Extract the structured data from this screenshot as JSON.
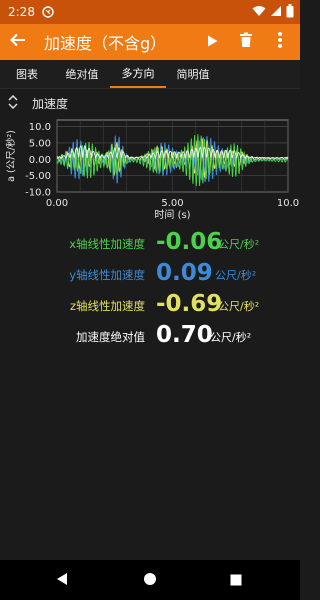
{
  "status": {
    "time": "2:28"
  },
  "toolbar": {
    "title": "加速度（不含g）"
  },
  "tabs": [
    {
      "label": "图表",
      "active": false
    },
    {
      "label": "绝对值",
      "active": false
    },
    {
      "label": "多方向",
      "active": true
    },
    {
      "label": "简明值",
      "active": false
    }
  ],
  "chart_header": {
    "title": "加速度"
  },
  "chart_data": {
    "type": "line",
    "xlabel": "时间 (s)",
    "ylabel": "a (公尺/秒²)",
    "xlim": [
      0,
      10
    ],
    "ylim": [
      -10,
      12
    ],
    "x_ticks": [
      "0.00",
      "5.00",
      "10.0"
    ],
    "y_ticks": [
      "10.0",
      "5.00",
      "0.00",
      "-5.00",
      "-10.0"
    ],
    "grid": true,
    "series": [
      {
        "color": "#3d8bd8"
      },
      {
        "color": "#e2e060"
      },
      {
        "color": "#4ad24a"
      },
      {
        "color": "#ffffff"
      }
    ]
  },
  "readouts": [
    {
      "label": "x轴线性加速度",
      "value": "-0.06",
      "unit": "公尺/秒²",
      "color": "#4ad24a"
    },
    {
      "label": "y轴线性加速度",
      "value": "0.09",
      "unit": "公尺/秒²",
      "color": "#3d8bd8"
    },
    {
      "label": "z轴线性加速度",
      "value": "-0.69",
      "unit": "公尺/秒²",
      "color": "#e2e060"
    },
    {
      "label": "加速度绝对值",
      "value": "0.70",
      "unit": "公尺/秒²",
      "color": "#ffffff"
    }
  ]
}
